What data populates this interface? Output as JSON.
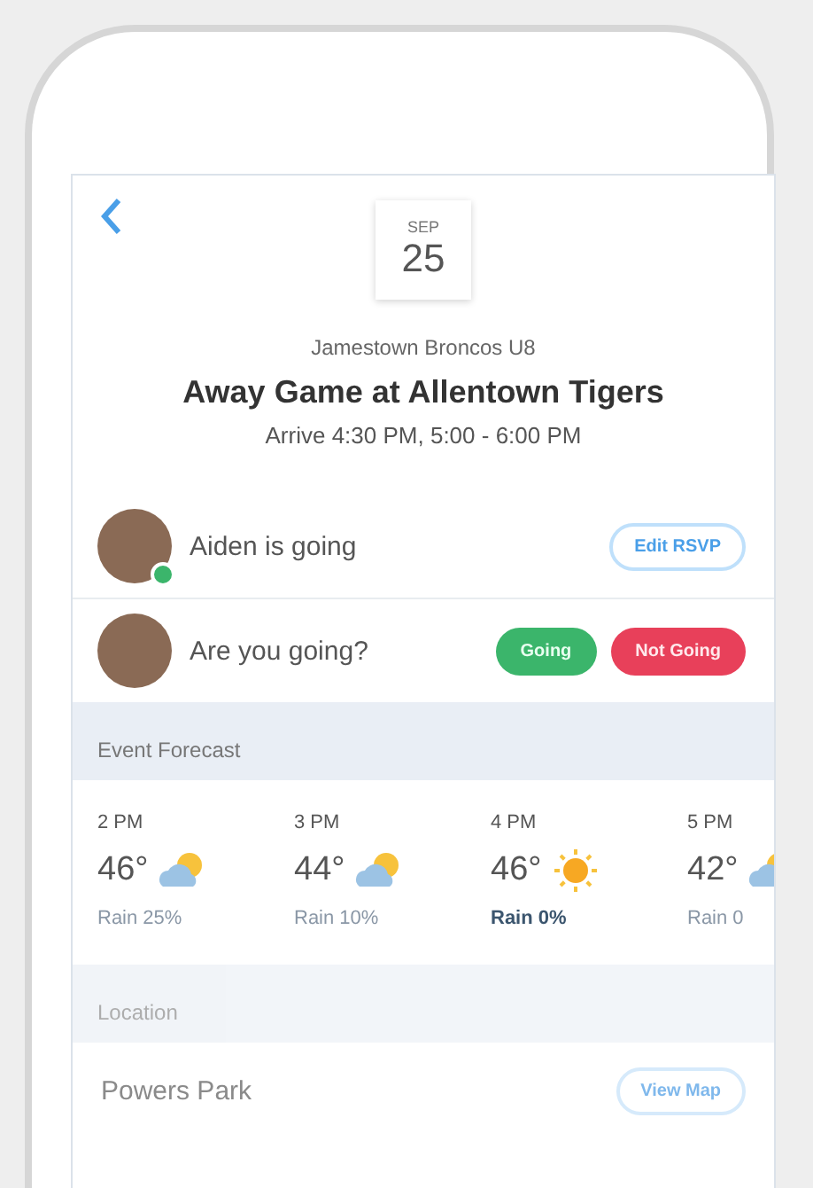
{
  "header": {
    "month": "SEP",
    "day": "25",
    "team": "Jamestown Broncos U8",
    "title": "Away Game at Allentown Tigers",
    "time": "Arrive 4:30 PM, 5:00 - 6:00 PM"
  },
  "rsvp": [
    {
      "text": "Aiden is going",
      "going": true,
      "buttons": [
        {
          "kind": "edit",
          "label": "Edit RSVP"
        }
      ]
    },
    {
      "text": "Are you going?",
      "going": false,
      "buttons": [
        {
          "kind": "going",
          "label": "Going"
        },
        {
          "kind": "not_going",
          "label": "Not Going"
        }
      ]
    }
  ],
  "forecast": {
    "heading": "Event Forecast",
    "hours": [
      {
        "time": "2 PM",
        "temp": "46°",
        "kind": "partly_cloudy",
        "rain": "Rain 25%",
        "selected": false
      },
      {
        "time": "3 PM",
        "temp": "44°",
        "kind": "partly_cloudy",
        "rain": "Rain 10%",
        "selected": false
      },
      {
        "time": "4 PM",
        "temp": "46°",
        "kind": "sunny",
        "rain": "Rain 0%",
        "selected": true
      },
      {
        "time": "5 PM",
        "temp": "42°",
        "kind": "partly_cloudy",
        "rain": "Rain 0",
        "selected": false
      }
    ]
  },
  "location": {
    "heading": "Location",
    "name": "Powers Park",
    "button": "View Map"
  }
}
